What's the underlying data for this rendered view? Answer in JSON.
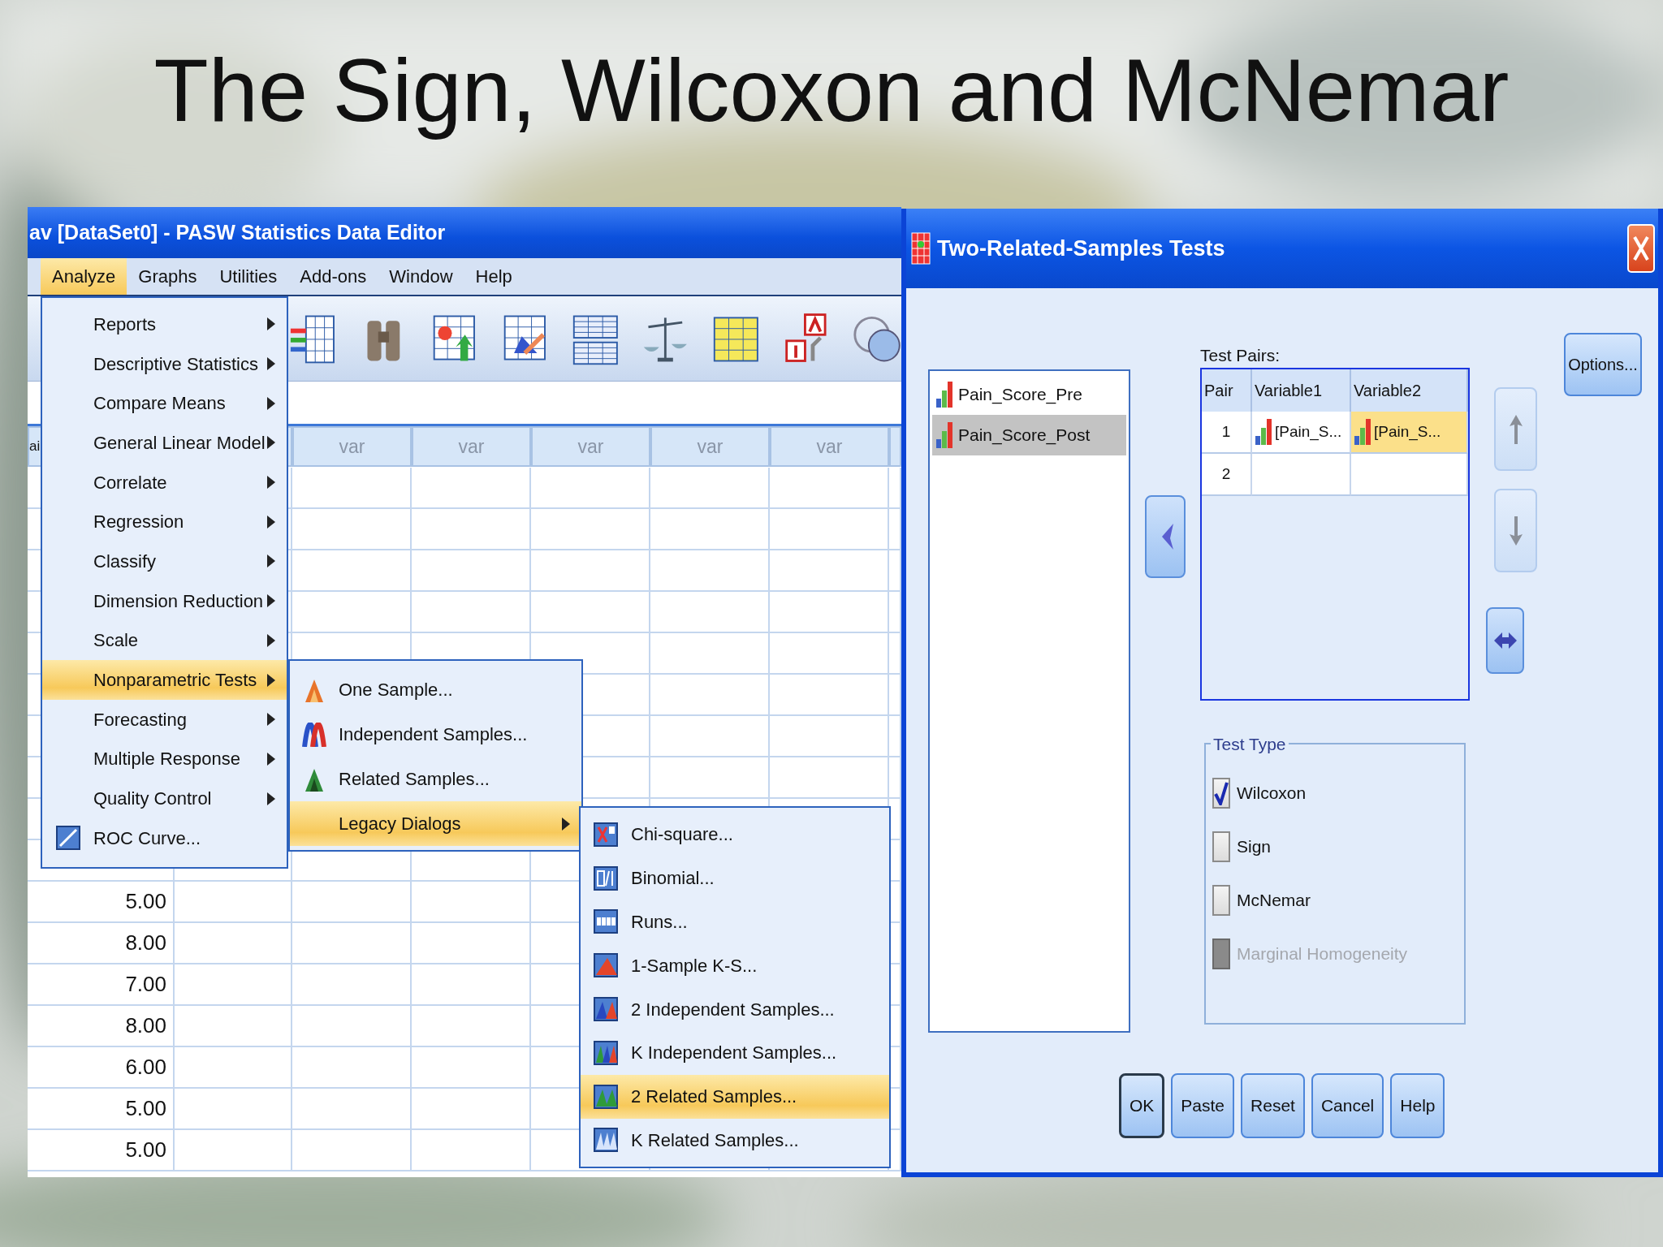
{
  "slide_title": "The Sign, Wilcoxon and McNemar",
  "data_editor": {
    "title": "av [DataSet0] - PASW Statistics Data Editor",
    "menu": [
      {
        "label": "Analyze",
        "selected": true
      },
      {
        "label": "Graphs",
        "selected": false
      },
      {
        "label": "Utilities",
        "selected": false
      },
      {
        "label": "Add-ons",
        "selected": false
      },
      {
        "label": "Window",
        "selected": false
      },
      {
        "label": "Help",
        "selected": false
      }
    ],
    "first_column_header": "ai",
    "column_headers": [
      "var",
      "var",
      "var",
      "var",
      "var"
    ],
    "first_column_values": [
      "5.00",
      "8.00",
      "7.00",
      "8.00",
      "6.00",
      "5.00",
      "5.00"
    ]
  },
  "analyze_menu": [
    {
      "label": "Reports",
      "submenu": true,
      "selected": false
    },
    {
      "label": "Descriptive Statistics",
      "submenu": true,
      "selected": false
    },
    {
      "label": "Compare Means",
      "submenu": true,
      "selected": false
    },
    {
      "label": "General Linear Model",
      "submenu": true,
      "selected": false
    },
    {
      "label": "Correlate",
      "submenu": true,
      "selected": false
    },
    {
      "label": "Regression",
      "submenu": true,
      "selected": false
    },
    {
      "label": "Classify",
      "submenu": true,
      "selected": false
    },
    {
      "label": "Dimension Reduction",
      "submenu": true,
      "selected": false
    },
    {
      "label": "Scale",
      "submenu": true,
      "selected": false
    },
    {
      "label": "Nonparametric Tests",
      "submenu": true,
      "selected": true
    },
    {
      "label": "Forecasting",
      "submenu": true,
      "selected": false
    },
    {
      "label": "Multiple Response",
      "submenu": true,
      "selected": false
    },
    {
      "label": "Quality Control",
      "submenu": true,
      "selected": false
    },
    {
      "label": "ROC Curve...",
      "submenu": false,
      "selected": false
    }
  ],
  "nonparametric_menu": [
    {
      "label": "One Sample...",
      "submenu": false,
      "selected": false
    },
    {
      "label": "Independent Samples...",
      "submenu": false,
      "selected": false
    },
    {
      "label": "Related Samples...",
      "submenu": false,
      "selected": false
    },
    {
      "label": "Legacy Dialogs",
      "submenu": true,
      "selected": true
    }
  ],
  "legacy_dialogs_menu": [
    {
      "label": "Chi-square...",
      "submenu": false,
      "selected": false
    },
    {
      "label": "Binomial...",
      "submenu": false,
      "selected": false
    },
    {
      "label": "Runs...",
      "submenu": false,
      "selected": false
    },
    {
      "label": "1-Sample K-S...",
      "submenu": false,
      "selected": false
    },
    {
      "label": "2 Independent Samples...",
      "submenu": false,
      "selected": false
    },
    {
      "label": "K Independent Samples...",
      "submenu": false,
      "selected": false
    },
    {
      "label": "2 Related Samples...",
      "submenu": false,
      "selected": true
    },
    {
      "label": "K Related Samples...",
      "submenu": false,
      "selected": false
    }
  ],
  "dialog": {
    "title": "Two-Related-Samples Tests",
    "variables": [
      {
        "name": "Pain_Score_Pre",
        "selected": false
      },
      {
        "name": "Pain_Score_Post",
        "selected": true
      }
    ],
    "test_pairs_label": "Test Pairs:",
    "pair_columns": [
      "Pair",
      "Variable1",
      "Variable2"
    ],
    "pairs": [
      {
        "cells": [
          {
            "text": "1",
            "selected": false
          },
          {
            "text": "[Pain_S...",
            "selected": false
          },
          {
            "text": "[Pain_S...",
            "selected": true
          }
        ]
      },
      {
        "cells": [
          {
            "text": "2",
            "selected": false
          }
        ]
      }
    ],
    "arrow_buttons": [
      {
        "kind": "move",
        "disabled": false
      },
      {
        "kind": "up",
        "disabled": true
      },
      {
        "kind": "down",
        "disabled": true
      },
      {
        "kind": "swap",
        "disabled": false
      }
    ],
    "options_button": "Options...",
    "test_type_label": "Test Type",
    "test_types": [
      {
        "label": "Wilcoxon",
        "checked": true,
        "disabled": false
      },
      {
        "label": "Sign",
        "checked": false,
        "disabled": false
      },
      {
        "label": "McNemar",
        "checked": false,
        "disabled": false
      },
      {
        "label": "Marginal Homogeneity",
        "checked": false,
        "disabled": true
      }
    ],
    "buttons": [
      {
        "label": "OK",
        "default": true
      },
      {
        "label": "Paste",
        "default": false
      },
      {
        "label": "Reset",
        "default": false
      },
      {
        "label": "Cancel",
        "default": false
      },
      {
        "label": "Help",
        "default": false
      }
    ]
  }
}
